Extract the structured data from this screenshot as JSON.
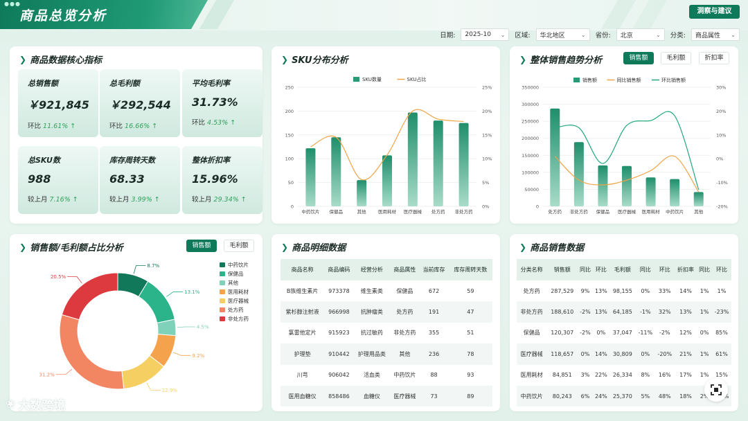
{
  "header": {
    "title": "商品总览分析",
    "insight_button": "洞察与建议"
  },
  "filters": [
    {
      "label": "日期:",
      "value": "2025-10"
    },
    {
      "label": "区域:",
      "value": "华北地区"
    },
    {
      "label": "省份:",
      "value": "北京"
    },
    {
      "label": "分类:",
      "value": "商品属性"
    }
  ],
  "kpi_panel": {
    "title": "商品数据核心指标"
  },
  "kpis": [
    {
      "label": "总销售额",
      "value": "￥921,845",
      "cmp_label": "环比",
      "cmp_value": "11.61%"
    },
    {
      "label": "总毛利额",
      "value": "￥292,544",
      "cmp_label": "环比",
      "cmp_value": "16.66%"
    },
    {
      "label": "平均毛利率",
      "value": "31.73%",
      "cmp_label": "环比",
      "cmp_value": "4.53%"
    },
    {
      "label": "总SKU数",
      "value": "988",
      "cmp_label": "较上月",
      "cmp_value": "7.16%"
    },
    {
      "label": "库存周转天数",
      "value": "68.33",
      "cmp_label": "较上月",
      "cmp_value": "3.99%"
    },
    {
      "label": "整体折扣率",
      "value": "15.96%",
      "cmp_label": "较上月",
      "cmp_value": "29.34%"
    }
  ],
  "sku_panel": {
    "title": "SKU分布分析"
  },
  "trend_panel": {
    "title": "整体销售趋势分析",
    "toggles": [
      "销售额",
      "毛利额",
      "折扣率"
    ],
    "active": "销售额"
  },
  "share_panel": {
    "title": "销售额/毛利额占比分析",
    "toggles": [
      "销售额",
      "毛利额"
    ],
    "active": "销售额"
  },
  "detail_panel": {
    "title": "商品明细数据"
  },
  "sales_panel": {
    "title": "商品销售数据"
  },
  "chart_data": [
    {
      "type": "bar",
      "id": "sku",
      "categories": [
        "中药饮片",
        "保健品",
        "其他",
        "医用耗材",
        "医疗器械",
        "处方药",
        "非处方药"
      ],
      "series": [
        {
          "name": "SKU数量",
          "type": "bar",
          "values": [
            122,
            145,
            55,
            107,
            197,
            180,
            175
          ]
        },
        {
          "name": "SKU占比",
          "type": "line",
          "axis": "right",
          "values": [
            12.5,
            14.5,
            5.6,
            10.8,
            20.0,
            18.3,
            17.8
          ]
        }
      ],
      "yticks": [
        "0",
        "50",
        "100",
        "150",
        "200",
        "250"
      ],
      "ylim": [
        0,
        250
      ],
      "y2ticks": [
        "0%",
        "5%",
        "10%",
        "15%",
        "20%",
        "25%"
      ],
      "y2lim": [
        0,
        25
      ],
      "legend": "top"
    },
    {
      "type": "bar",
      "id": "trend",
      "categories": [
        "处方药",
        "非处方药",
        "保健品",
        "医疗器械",
        "医用耗材",
        "中药饮片",
        "其他"
      ],
      "series": [
        {
          "name": "销售额",
          "type": "bar",
          "values": [
            287529,
            188610,
            120307,
            118657,
            84851,
            80243,
            42000
          ]
        },
        {
          "name": "同比销售额",
          "type": "line",
          "axis": "right",
          "values": [
            1,
            -9,
            -11,
            -9,
            -5,
            1,
            -14
          ]
        },
        {
          "name": "环比销售额",
          "type": "line",
          "axis": "right",
          "values": [
            13,
            13,
            -2,
            14,
            16,
            18,
            -13
          ]
        }
      ],
      "yticks": [
        "0",
        "50000",
        "100000",
        "150000",
        "200000",
        "250000",
        "300000",
        "350000"
      ],
      "ylim": [
        0,
        350000
      ],
      "y2ticks": [
        "-20%",
        "-10%",
        "0%",
        "10%",
        "20%",
        "30%"
      ],
      "y2lim": [
        -20,
        30
      ],
      "legend": "top"
    },
    {
      "type": "pie",
      "id": "share",
      "slices": [
        {
          "name": "中药饮片",
          "value": 8.7,
          "label": "8.7%",
          "color": "#11795a"
        },
        {
          "name": "保健品",
          "value": 13.1,
          "label": "13.1%",
          "color": "#2bb38a"
        },
        {
          "name": "其他",
          "value": 4.5,
          "label": "4.5%",
          "color": "#7fd1b9"
        },
        {
          "name": "医用耗材",
          "value": 9.2,
          "label": "9.2%",
          "color": "#f4a24c"
        },
        {
          "name": "医疗器械",
          "value": 12.9,
          "label": "12.9%",
          "color": "#f6cf62"
        },
        {
          "name": "处方药",
          "value": 31.2,
          "label": "31.2%",
          "color": "#f28562"
        },
        {
          "name": "非处方药",
          "value": 20.5,
          "label": "20.5%",
          "color": "#dc3a3f"
        }
      ],
      "legend": "right"
    }
  ],
  "detail_table": {
    "columns": [
      "商品名称",
      "商品编码",
      "经营分析",
      "商品属性",
      "当前库存",
      "库存周转天数"
    ],
    "rows": [
      [
        "B族维生素片",
        "973378",
        "维生素类",
        "保健品",
        "672",
        "59"
      ],
      [
        "紫杉醇注射液",
        "966998",
        "抗肿瘤类",
        "处方药",
        "191",
        "47"
      ],
      [
        "氯雷他定片",
        "915923",
        "抗过敏药",
        "非处方药",
        "355",
        "51"
      ],
      [
        "护理垫",
        "910442",
        "护理用品类",
        "其他",
        "236",
        "78"
      ],
      [
        "川芎",
        "906042",
        "活血类",
        "中药饮片",
        "88",
        "93"
      ],
      [
        "医用血糖仪",
        "858486",
        "血糖仪",
        "医疗器械",
        "73",
        "89"
      ]
    ]
  },
  "sales_table": {
    "columns": [
      "分类名称",
      "销售额",
      "同比",
      "环比",
      "毛利额",
      "同比",
      "环比",
      "折扣率",
      "同比",
      "环比"
    ],
    "rows": [
      [
        "处方药",
        "287,529",
        "9%",
        "13%",
        "98,155",
        "0%",
        "33%",
        "14%",
        "1%",
        "1%"
      ],
      [
        "非处方药",
        "188,610",
        "-2%",
        "13%",
        "64,185",
        "-1%",
        "32%",
        "13%",
        "1%",
        "-23%"
      ],
      [
        "保健品",
        "120,307",
        "-2%",
        "0%",
        "37,047",
        "-11%",
        "-2%",
        "12%",
        "0%",
        "85%"
      ],
      [
        "医疗器械",
        "118,657",
        "0%",
        "14%",
        "30,809",
        "0%",
        "-20%",
        "21%",
        "1%",
        "61%"
      ],
      [
        "医用耗材",
        "84,851",
        "3%",
        "22%",
        "26,334",
        "8%",
        "16%",
        "17%",
        "1%",
        "15%"
      ],
      [
        "中药饮片",
        "80,243",
        "6%",
        "24%",
        "25,370",
        "5%",
        "48%",
        "18%",
        "2%",
        "-16%"
      ]
    ]
  },
  "watermark": "大数跨境",
  "icons": {
    "title_arrow": "chevron-double-right-icon",
    "up": "arrow-up-icon",
    "scan": "scan-icon"
  }
}
